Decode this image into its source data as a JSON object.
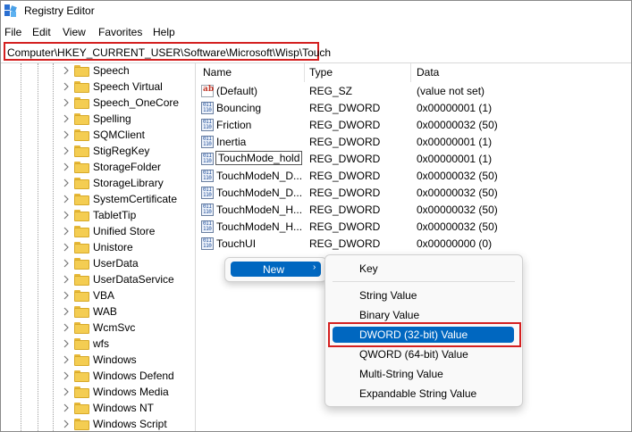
{
  "window": {
    "title": "Registry Editor"
  },
  "menu": [
    "File",
    "Edit",
    "View",
    "Favorites",
    "Help"
  ],
  "address": "Computer\\HKEY_CURRENT_USER\\Software\\Microsoft\\Wisp\\Touch",
  "tree": [
    "Speech",
    "Speech Virtual",
    "Speech_OneCore",
    "Spelling",
    "SQMClient",
    "StigRegKey",
    "StorageFolder",
    "StorageLibrary",
    "SystemCertificate",
    "TabletTip",
    "Unified Store",
    "Unistore",
    "UserData",
    "UserDataService",
    "VBA",
    "WAB",
    "WcmSvc",
    "wfs",
    "Windows",
    "Windows Defend",
    "Windows Media",
    "Windows NT",
    "Windows Script"
  ],
  "columns": {
    "name": "Name",
    "type": "Type",
    "data": "Data"
  },
  "values": [
    {
      "name": "(Default)",
      "type": "REG_SZ",
      "data": "(value not set)",
      "icon": "string-value-icon"
    },
    {
      "name": "Bouncing",
      "type": "REG_DWORD",
      "data": "0x00000001 (1)",
      "icon": "dword-value-icon"
    },
    {
      "name": "Friction",
      "type": "REG_DWORD",
      "data": "0x00000032 (50)",
      "icon": "dword-value-icon"
    },
    {
      "name": "Inertia",
      "type": "REG_DWORD",
      "data": "0x00000001 (1)",
      "icon": "dword-value-icon"
    },
    {
      "name": "TouchMode_hold",
      "type": "REG_DWORD",
      "data": "0x00000001 (1)",
      "icon": "dword-value-icon"
    },
    {
      "name": "TouchModeN_D...",
      "type": "REG_DWORD",
      "data": "0x00000032 (50)",
      "icon": "dword-value-icon"
    },
    {
      "name": "TouchModeN_D...",
      "type": "REG_DWORD",
      "data": "0x00000032 (50)",
      "icon": "dword-value-icon"
    },
    {
      "name": "TouchModeN_H...",
      "type": "REG_DWORD",
      "data": "0x00000032 (50)",
      "icon": "dword-value-icon"
    },
    {
      "name": "TouchModeN_H...",
      "type": "REG_DWORD",
      "data": "0x00000032 (50)",
      "icon": "dword-value-icon"
    },
    {
      "name": "TouchUI",
      "type": "REG_DWORD",
      "data": "0x00000000 (0)",
      "icon": "dword-value-icon"
    }
  ],
  "context_menu": {
    "new_label": "New",
    "arrow": "›"
  },
  "submenu": {
    "key": "Key",
    "string": "String Value",
    "binary": "Binary Value",
    "dword": "DWORD (32-bit) Value",
    "qword": "QWORD (64-bit) Value",
    "multi": "Multi-String Value",
    "expandable": "Expandable String Value"
  },
  "dword_icon_text": "011\n110",
  "string_icon_text": "ab",
  "colors": {
    "accent": "#0067c0",
    "highlight_border": "#d42020",
    "folder": "#f4cd52"
  }
}
